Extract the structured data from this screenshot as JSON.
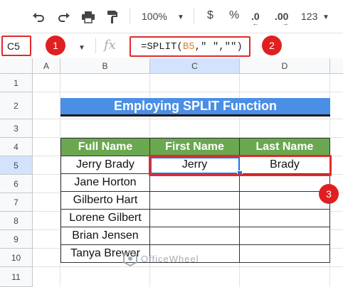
{
  "toolbar": {
    "undo_icon": "undo-icon",
    "redo_icon": "redo-icon",
    "print_icon": "print-icon",
    "paint_format_icon": "paint-format-icon",
    "zoom": "100%",
    "currency": "$",
    "percent": "%",
    "decrease_decimal": ".0",
    "increase_decimal": ".00",
    "more_formats": "123"
  },
  "formula_bar": {
    "name_box": "C5",
    "fx_label": "fx",
    "formula_prefix": "=SPLIT(",
    "formula_ref": "B5",
    "formula_rest": ",\" \",\"\")"
  },
  "badges": {
    "one": "1",
    "two": "2",
    "three": "3"
  },
  "grid": {
    "columns": [
      "A",
      "B",
      "C",
      "D"
    ],
    "rows": [
      "1",
      "2",
      "3",
      "4",
      "5",
      "6",
      "7",
      "8",
      "9",
      "10",
      "11"
    ]
  },
  "sheet": {
    "title": "Employing SPLIT Function",
    "headers": [
      "Full Name",
      "First Name",
      "Last Name"
    ],
    "rows": [
      [
        "Jerry Brady",
        "Jerry",
        "Brady"
      ],
      [
        "Jane Horton",
        "",
        ""
      ],
      [
        "Gilberto Hart",
        "",
        ""
      ],
      [
        "Lorene Gilbert",
        "",
        ""
      ],
      [
        "Brian Jensen",
        "",
        ""
      ],
      [
        "Tanya Brewer",
        "",
        ""
      ]
    ]
  },
  "watermark": "OfficeWheel",
  "colors": {
    "title_bg": "#4a8ee6",
    "header_bg": "#6aa84f",
    "highlight": "#e02b2b",
    "selection": "#1a73e8"
  }
}
